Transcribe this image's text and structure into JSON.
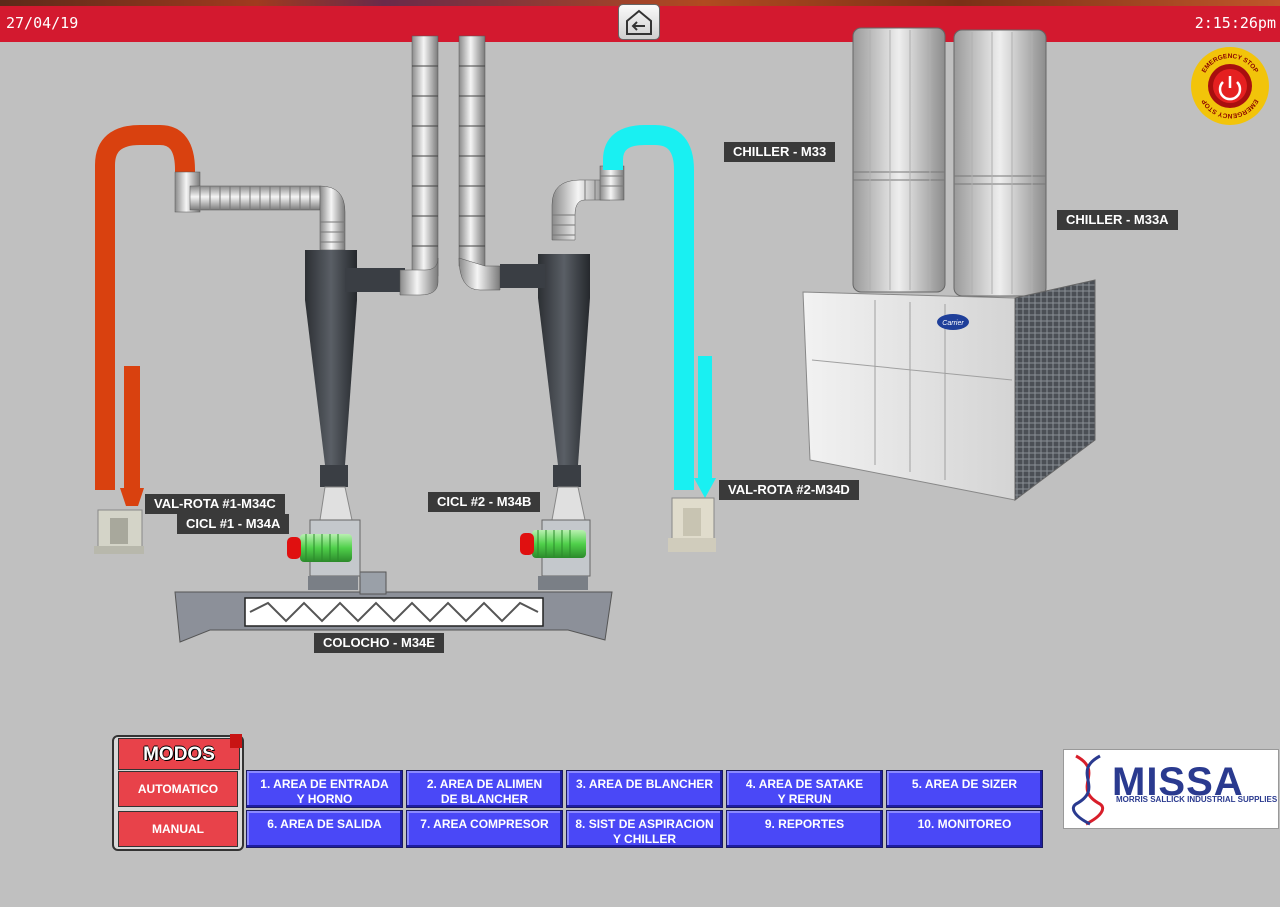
{
  "header": {
    "date": "27/04/19",
    "time": "2:15:26pm",
    "home_icon": "back-arrow-icon"
  },
  "emergency_stop": {
    "text_top": "EMERGENCY STOP",
    "text_bottom": "EMERGENCY STOP"
  },
  "equipment_labels": {
    "chiller_m33": "CHILLER - M33",
    "chiller_m33a": "CHILLER - M33A",
    "val_rota_1": "VAL-ROTA #1-M34C",
    "cicl_1": "CICL #1 - M34A",
    "cicl_2": "CICL #2 - M34B",
    "val_rota_2": "VAL-ROTA #2-M34D",
    "colocho": "COLOCHO - M34E",
    "chiller_brand": "Carrier"
  },
  "modes": {
    "title": "MODOS",
    "automatic": "AUTOMATICO",
    "manual": "MANUAL"
  },
  "nav": {
    "b1": "1. AREA DE ENTRADA\nY HORNO",
    "b2": "2. AREA DE ALIMEN\nDE BLANCHER",
    "b3": "3. AREA DE BLANCHER",
    "b4": "4. AREA DE SATAKE\nY RERUN",
    "b5": "5. AREA DE SIZER",
    "b6": "6. AREA DE SALIDA",
    "b7": "7. AREA COMPRESOR",
    "b8": "8. SIST DE ASPIRACION\nY CHILLER",
    "b9": "9. REPORTES",
    "b10": "10. MONITOREO"
  },
  "logo": {
    "name": "MISSA",
    "subtitle": "MORRIS SALLICK INDUSTRIAL SUPPLIES"
  },
  "colors": {
    "header_red": "#d3192f",
    "orange_duct": "#d9410f",
    "cyan_duct": "#19f0f2",
    "nav_blue": "#4a48f7",
    "mode_red": "#e8424a",
    "background": "#c0c0c0"
  }
}
